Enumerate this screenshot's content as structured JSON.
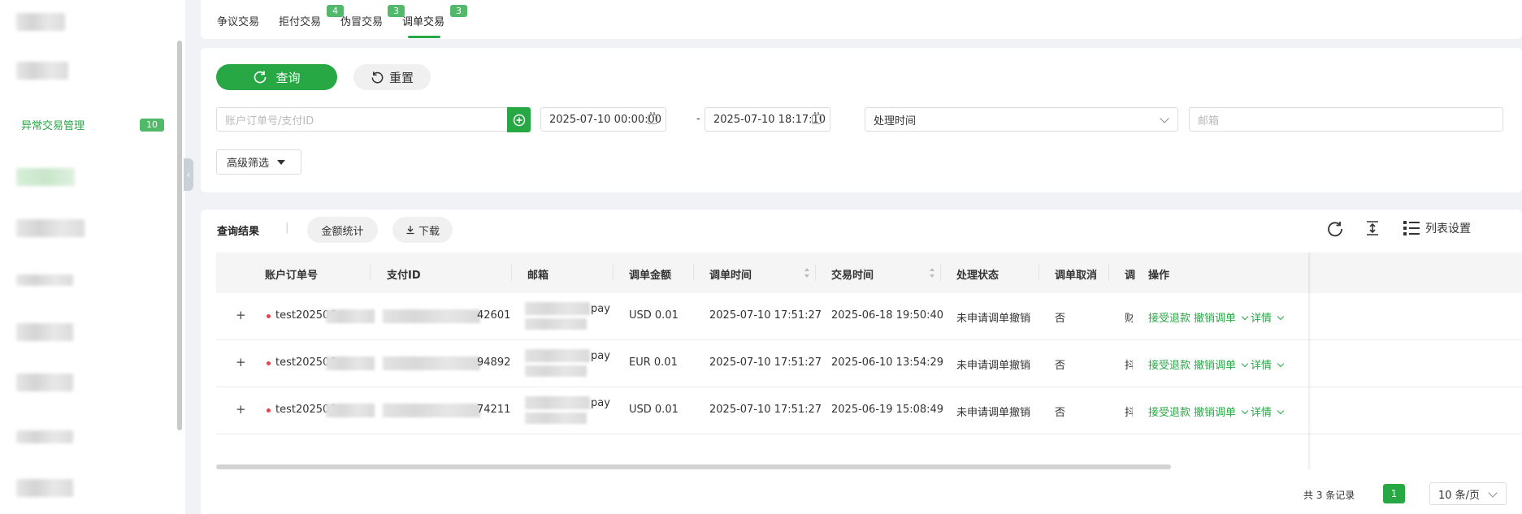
{
  "sidebar": {
    "active_item": {
      "label": "异常交易管理",
      "badge": "10"
    }
  },
  "tabs": [
    {
      "label": "争议交易",
      "badge": null
    },
    {
      "label": "拒付交易",
      "badge": "4"
    },
    {
      "label": "伪冒交易",
      "badge": "3"
    },
    {
      "label": "调单交易",
      "badge": "3",
      "active": true
    }
  ],
  "filters": {
    "query_label": "查询",
    "reset_label": "重置",
    "order_placeholder": "账户订单号/支付ID",
    "start_time": "2025-07-10 00:00:00",
    "range_sep": "-",
    "end_time": "2025-07-10 18:17:10",
    "time_type": "处理时间",
    "email_placeholder": "邮箱",
    "advanced_label": "高级筛选"
  },
  "results": {
    "title": "查询结果",
    "separator": "|",
    "amount_stats_label": "金额统计",
    "download_label": "下载",
    "column_settings_label": "列表设置",
    "columns": [
      "账户订单号",
      "支付ID",
      "邮箱",
      "调单金额",
      "调单时间",
      "交易时间",
      "处理状态",
      "调单取消",
      "调",
      "操作"
    ],
    "rows": [
      {
        "expand": "+",
        "order_prefix": "test202506",
        "pay_id_suffix": "42601",
        "email_suffix": "pay",
        "amount": "USD 0.01",
        "dispute_time": "2025-07-10 17:51:27",
        "trade_time": "2025-06-18 19:50:40",
        "status": "未申请调单撤销",
        "cancelled": "否",
        "trunc": "财"
      },
      {
        "expand": "+",
        "order_prefix": "test202506",
        "pay_id_suffix": "94892",
        "email_suffix": "pay",
        "amount": "EUR 0.01",
        "dispute_time": "2025-07-10 17:51:27",
        "trade_time": "2025-06-10 13:54:29",
        "status": "未申请调单撤销",
        "cancelled": "否",
        "trunc": "抖"
      },
      {
        "expand": "+",
        "order_prefix": "test202506",
        "pay_id_suffix": "74211",
        "email_suffix": "pay",
        "amount": "USD 0.01",
        "dispute_time": "2025-07-10 17:51:27",
        "trade_time": "2025-06-19 15:08:49",
        "status": "未申请调单撤销",
        "cancelled": "否",
        "trunc": "抖"
      }
    ],
    "actions": {
      "accept": "接受退款",
      "revoke": "撤销调单",
      "detail": "详情"
    }
  },
  "pagination": {
    "total_text": "共 3 条记录",
    "current_page": "1",
    "page_size": "10 条/页"
  },
  "colors": {
    "accent": "#28a745",
    "badge": "#52b86a",
    "dot": "#e54545"
  }
}
